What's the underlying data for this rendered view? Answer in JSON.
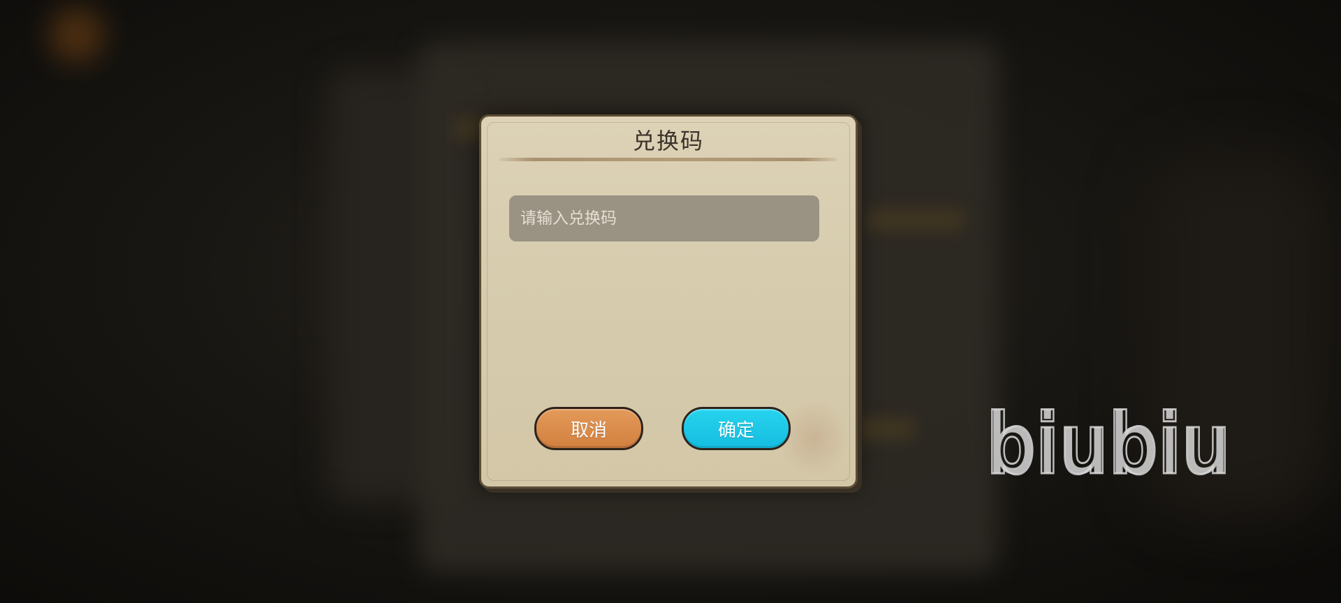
{
  "dialog": {
    "title": "兑换码",
    "code_input": {
      "value": "",
      "placeholder": "请输入兑换码"
    },
    "cancel_label": "取消",
    "confirm_label": "确定"
  },
  "watermark": {
    "text": "biubiu"
  },
  "colors": {
    "dialog_bg": "#d8ccae",
    "cancel_button": "#dc8f4c",
    "confirm_button": "#1fc9e8",
    "input_bg": "#9a9283"
  }
}
